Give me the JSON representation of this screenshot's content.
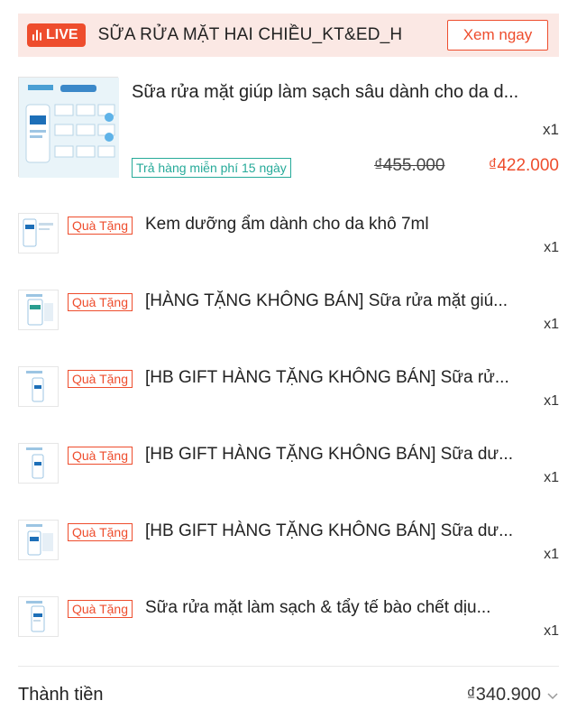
{
  "header": {
    "live_label": "LIVE",
    "shop_name": "SỮA RỬA MẶT HAI CHIỀU_KT&ED_H",
    "view_button": "Xem ngay"
  },
  "main_item": {
    "title": "Sữa rửa mặt giúp làm sạch sâu dành cho da d...",
    "quantity": "x1",
    "return_badge": "Trả hàng miễn phí 15 ngày",
    "original_price": "₫455.000",
    "sale_price": "₫422.000"
  },
  "gift_tag": "Quà Tặng",
  "gift_items": [
    {
      "title": "Kem dưỡng ẩm dành cho da khô 7ml",
      "quantity": "x1"
    },
    {
      "title": "[HÀNG TẶNG KHÔNG BÁN] Sữa rửa mặt giú...",
      "quantity": "x1"
    },
    {
      "title": "[HB GIFT HÀNG TẶNG KHÔNG BÁN] Sữa rử...",
      "quantity": "x1"
    },
    {
      "title": "[HB GIFT HÀNG TẶNG KHÔNG BÁN] Sữa dư...",
      "quantity": "x1"
    },
    {
      "title": "[HB GIFT HÀNG TẶNG KHÔNG BÁN] Sữa dư...",
      "quantity": "x1"
    },
    {
      "title": "Sữa rửa mặt làm sạch & tẩy tế bào chết dịu...",
      "quantity": "x1"
    }
  ],
  "total": {
    "label": "Thành tiền",
    "value": "₫340.900"
  },
  "icons": [
    "live-bars-icon",
    "product-image",
    "gift-product-image",
    "chevron-down-icon"
  ],
  "colors": {
    "accent": "#ee4d2d",
    "header_bg": "#fbe8e4",
    "return_badge": "#26aa99"
  }
}
